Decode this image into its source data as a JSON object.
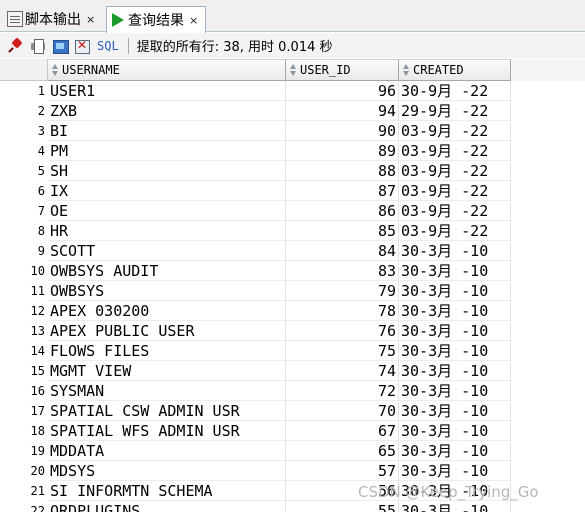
{
  "tabs": [
    {
      "label": "脚本输出",
      "close": "×",
      "icon": "script-output-icon",
      "active": false
    },
    {
      "label": "查询结果",
      "close": "×",
      "icon": "run-query-icon",
      "active": true
    }
  ],
  "toolbar": {
    "icons": [
      "pin-icon",
      "print-icon",
      "refresh-icon",
      "clear-icon"
    ],
    "sql_label": "SQL",
    "status": "提取的所有行: 38, 用时 0.014 秒"
  },
  "grid": {
    "columns": [
      "USERNAME",
      "USER_ID",
      "CREATED"
    ],
    "rows": [
      {
        "num": "1",
        "username": "USER1",
        "user_id": "96",
        "created": "30-9月 -22"
      },
      {
        "num": "2",
        "username": "ZXB",
        "user_id": "94",
        "created": "29-9月 -22"
      },
      {
        "num": "3",
        "username": "BI",
        "user_id": "90",
        "created": "03-9月 -22"
      },
      {
        "num": "4",
        "username": "PM",
        "user_id": "89",
        "created": "03-9月 -22"
      },
      {
        "num": "5",
        "username": "SH",
        "user_id": "88",
        "created": "03-9月 -22"
      },
      {
        "num": "6",
        "username": "IX",
        "user_id": "87",
        "created": "03-9月 -22"
      },
      {
        "num": "7",
        "username": "OE",
        "user_id": "86",
        "created": "03-9月 -22"
      },
      {
        "num": "8",
        "username": "HR",
        "user_id": "85",
        "created": "03-9月 -22"
      },
      {
        "num": "9",
        "username": "SCOTT",
        "user_id": "84",
        "created": "30-3月 -10"
      },
      {
        "num": "10",
        "username": "OWBSYS AUDIT",
        "user_id": "83",
        "created": "30-3月 -10"
      },
      {
        "num": "11",
        "username": "OWBSYS",
        "user_id": "79",
        "created": "30-3月 -10"
      },
      {
        "num": "12",
        "username": "APEX 030200",
        "user_id": "78",
        "created": "30-3月 -10"
      },
      {
        "num": "13",
        "username": "APEX PUBLIC USER",
        "user_id": "76",
        "created": "30-3月 -10"
      },
      {
        "num": "14",
        "username": "FLOWS FILES",
        "user_id": "75",
        "created": "30-3月 -10"
      },
      {
        "num": "15",
        "username": "MGMT VIEW",
        "user_id": "74",
        "created": "30-3月 -10"
      },
      {
        "num": "16",
        "username": "SYSMAN",
        "user_id": "72",
        "created": "30-3月 -10"
      },
      {
        "num": "17",
        "username": "SPATIAL CSW ADMIN USR",
        "user_id": "70",
        "created": "30-3月 -10"
      },
      {
        "num": "18",
        "username": "SPATIAL WFS ADMIN USR",
        "user_id": "67",
        "created": "30-3月 -10"
      },
      {
        "num": "19",
        "username": "MDDATA",
        "user_id": "65",
        "created": "30-3月 -10"
      },
      {
        "num": "20",
        "username": "MDSYS",
        "user_id": "57",
        "created": "30-3月 -10"
      },
      {
        "num": "21",
        "username": "SI INFORMTN SCHEMA",
        "user_id": "56",
        "created": "30-3月 -10"
      },
      {
        "num": "22",
        "username": "ORDPLUGINS",
        "user_id": "55",
        "created": "30-3月 -10"
      }
    ]
  },
  "watermark": "CSDN @Keep_Trying_Go"
}
